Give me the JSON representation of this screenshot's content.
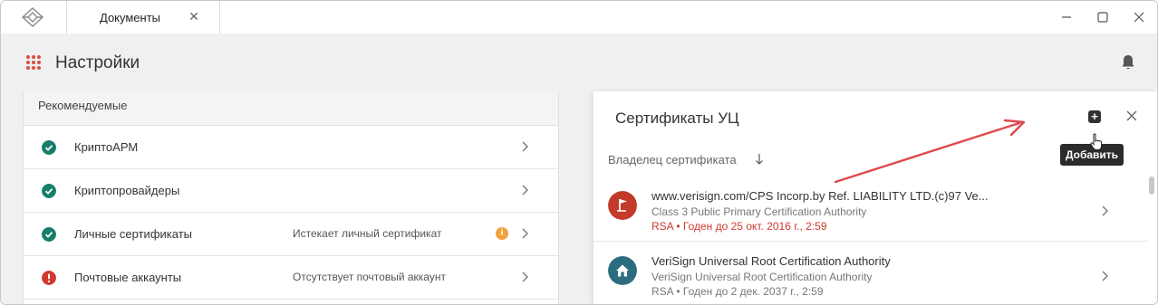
{
  "window": {
    "tab_label": "Документы",
    "tab_close": "✕"
  },
  "header": {
    "title": "Настройки"
  },
  "settings": {
    "section": "Рекомендуемые",
    "rows": [
      {
        "label": "КриптоАРМ",
        "note": "",
        "status": "ok"
      },
      {
        "label": "Криптопровайдеры",
        "note": "",
        "status": "ok"
      },
      {
        "label": "Личные сертификаты",
        "note": "Истекает личный сертификат",
        "status": "ok",
        "warn": "i"
      },
      {
        "label": "Почтовые аккаунты",
        "note": "Отсутствует почтовый аккаунт",
        "status": "error"
      }
    ]
  },
  "panel": {
    "title": "Сертификаты УЦ",
    "add_glyph": "+",
    "tooltip": "Добавить",
    "sort_label": "Владелец сертификата",
    "certs": [
      {
        "title": "www.verisign.com/CPS Incorp.by Ref. LIABILITY LTD.(c)97 Ve...",
        "subtitle": "Class 3 Public Primary Certification Authority",
        "meta": "RSA • Годен до 25 окт. 2016 г., 2:59",
        "expired": true,
        "icon": "flag-icon"
      },
      {
        "title": "VeriSign Universal Root Certification Authority",
        "subtitle": "VeriSign Universal Root Certification Authority",
        "meta": "RSA • Годен до 2 дек. 2037 г., 2:59",
        "expired": false,
        "icon": "home-icon"
      }
    ]
  },
  "colors": {
    "ok": "#177e6c",
    "error": "#d0392f",
    "warn": "#f0a23b",
    "expired_text": "#d0392f",
    "flag_bg": "#c23a2a",
    "home_bg": "#2b6c7e",
    "annotation": "#e0484a"
  }
}
